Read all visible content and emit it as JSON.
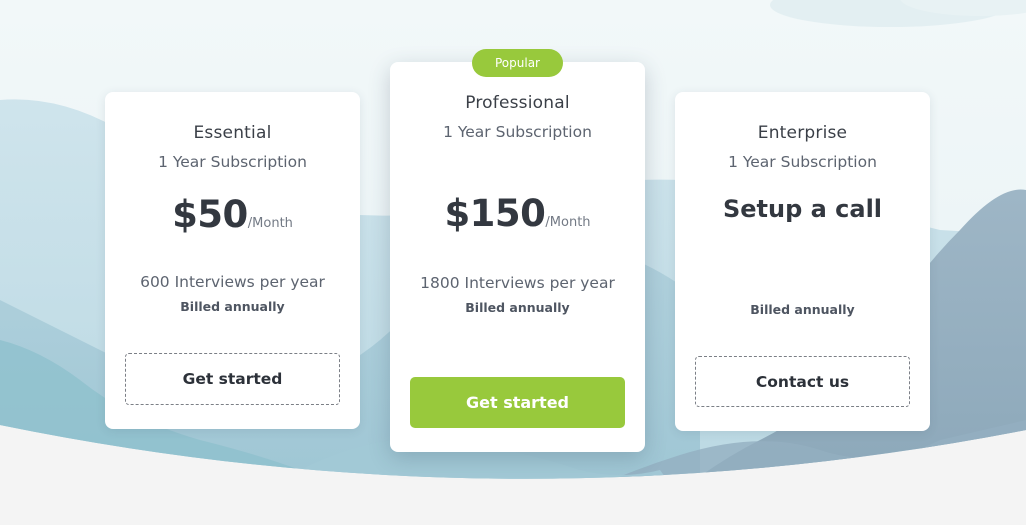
{
  "colors": {
    "accent_green": "#98c93c",
    "card_bg": "#ffffff",
    "heading_text": "#333840",
    "page_bg": "#f4f4f4"
  },
  "plans": [
    {
      "name": "Essential",
      "subscription": "1 Year Subscription",
      "price_amount": "$50",
      "price_period": "/Month",
      "feature": "600 Interviews per year",
      "billing": "Billed annually",
      "cta": "Get started"
    },
    {
      "badge": "Popular",
      "name": "Professional",
      "subscription": "1 Year Subscription",
      "price_amount": "$150",
      "price_period": "/Month",
      "feature": "1800 Interviews per year",
      "billing": "Billed annually",
      "cta": "Get started"
    },
    {
      "name": "Enterprise",
      "subscription": "1 Year Subscription",
      "price_text": "Setup a call",
      "billing": "Billed annually",
      "cta": "Contact us"
    }
  ]
}
